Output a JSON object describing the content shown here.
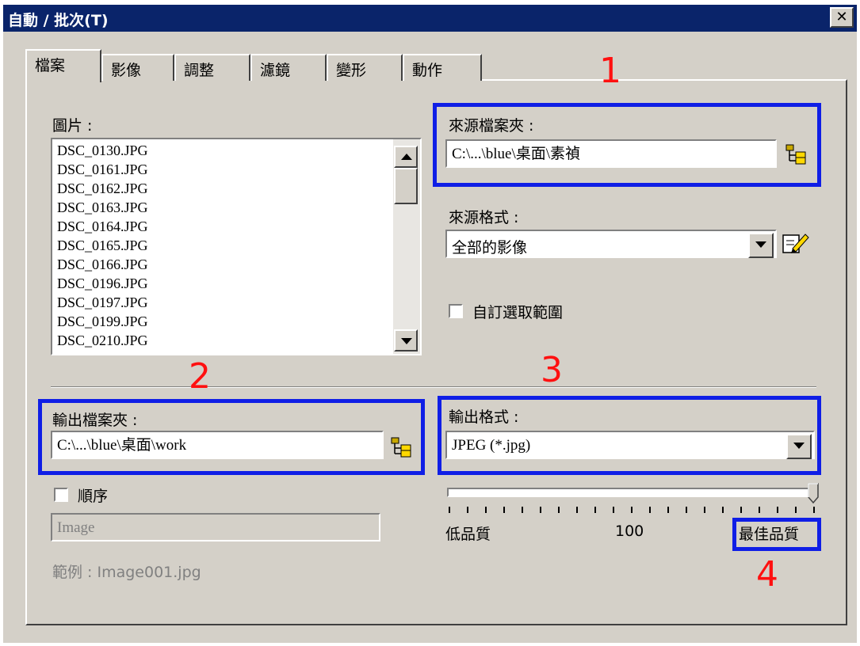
{
  "window": {
    "title": "自動 / 批次(T)",
    "close_label": "✕"
  },
  "tabs": [
    {
      "label": "檔案"
    },
    {
      "label": "影像"
    },
    {
      "label": "調整"
    },
    {
      "label": "濾鏡"
    },
    {
      "label": "變形"
    },
    {
      "label": "動作"
    }
  ],
  "pictures": {
    "label": "圖片 :",
    "items": [
      "DSC_0130.JPG",
      "DSC_0161.JPG",
      "DSC_0162.JPG",
      "DSC_0163.JPG",
      "DSC_0164.JPG",
      "DSC_0165.JPG",
      "DSC_0166.JPG",
      "DSC_0196.JPG",
      "DSC_0197.JPG",
      "DSC_0199.JPG",
      "DSC_0210.JPG"
    ]
  },
  "source_folder": {
    "label": "來源檔案夾 :",
    "value": "C:\\...\\blue\\桌面\\素禎"
  },
  "source_format": {
    "label": "來源格式 :",
    "value": "全部的影像"
  },
  "custom_range": {
    "label": "自訂選取範圍",
    "checked": false
  },
  "output_folder": {
    "label": "輸出檔案夾 :",
    "value": "C:\\...\\blue\\桌面\\work"
  },
  "output_format": {
    "label": "輸出格式 :",
    "value": "JPEG (*.jpg)"
  },
  "sequence": {
    "label": "順序",
    "checked": false,
    "name_value": "Image",
    "example": "範例 : Image001.jpg"
  },
  "quality": {
    "low_label": "低品質",
    "value_text": "100",
    "high_label": "最佳品質",
    "level": 1.0
  },
  "annotations": {
    "n1": "1",
    "n2": "2",
    "n3": "3",
    "n4": "4"
  },
  "colors": {
    "title_bar": "#0a246a",
    "dialog_face": "#d4d0c8",
    "highlight_box": "#0f1ee6",
    "annotation_red": "#ff1010"
  }
}
